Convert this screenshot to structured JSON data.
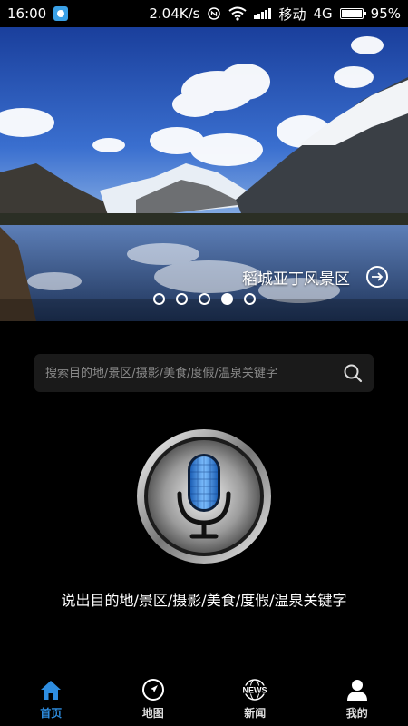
{
  "status_bar": {
    "time": "16:00",
    "speed": "2.04K/s",
    "carrier": "移动",
    "network": "4G",
    "battery": "95%",
    "battery_level": 0.95,
    "icons": [
      "app-badge-icon",
      "nfc-icon",
      "wifi-icon",
      "signal-icon",
      "battery-icon"
    ]
  },
  "banner": {
    "caption": "稻城亚丁风景区",
    "arrow_icon": "arrow-right-circle-icon",
    "dot_count": 5,
    "active_dot_index": 3
  },
  "search": {
    "placeholder": "搜索目的地/景区/摄影/美食/度假/温泉关键字",
    "icon": "search-icon"
  },
  "voice": {
    "icon": "microphone-icon",
    "hint": "说出目的地/景区/摄影/美食/度假/温泉关键字"
  },
  "bottom_nav": {
    "items": [
      {
        "label": "首页",
        "icon": "home-icon",
        "active": true
      },
      {
        "label": "地图",
        "icon": "compass-icon",
        "active": false
      },
      {
        "label": "新闻",
        "icon": "news-icon",
        "active": false
      },
      {
        "label": "我的",
        "icon": "user-icon",
        "active": false
      }
    ],
    "news_icon_text": "NEWS",
    "active_color": "#2e8de0"
  }
}
